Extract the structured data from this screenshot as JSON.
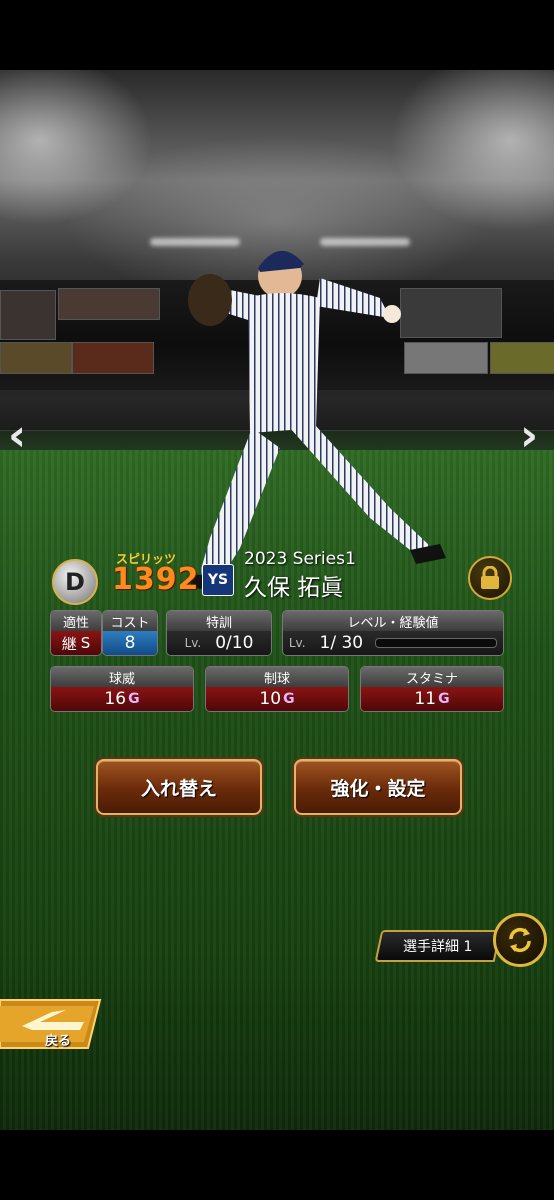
{
  "player": {
    "rank": "D",
    "spirits_label": "スピリッツ",
    "spirits_value": "1392",
    "team_logo_text": "YS",
    "series": "2023 Series1",
    "name": "久保 拓眞"
  },
  "stats": {
    "aptitude_label": "適性",
    "aptitude_value": "継",
    "aptitude_grade": "S",
    "cost_label": "コスト",
    "cost_value": "8",
    "training_label": "特訓",
    "training_lv": "Lv.",
    "training_value": "0/10",
    "level_label": "レベル・経験値",
    "level_lv": "Lv.",
    "level_value": "1/ 30",
    "velocity_label": "球威",
    "velocity_value": "16",
    "velocity_grade": "G",
    "control_label": "制球",
    "control_value": "10",
    "control_grade": "G",
    "stamina_label": "スタミナ",
    "stamina_value": "11",
    "stamina_grade": "G"
  },
  "buttons": {
    "swap": "入れ替え",
    "enhance": "強化・設定",
    "detail": "選手詳細 1",
    "back": "戻る"
  },
  "icons": {
    "prev": "chevron-left-icon",
    "next": "chevron-right-icon",
    "lock": "lock-icon",
    "switch": "rotate-arrows-icon"
  },
  "colors": {
    "spirits": "#ff8a1e",
    "button_border": "#e3b36a",
    "stat_red": "#8a1414",
    "stat_blue": "#2d7ec1"
  }
}
